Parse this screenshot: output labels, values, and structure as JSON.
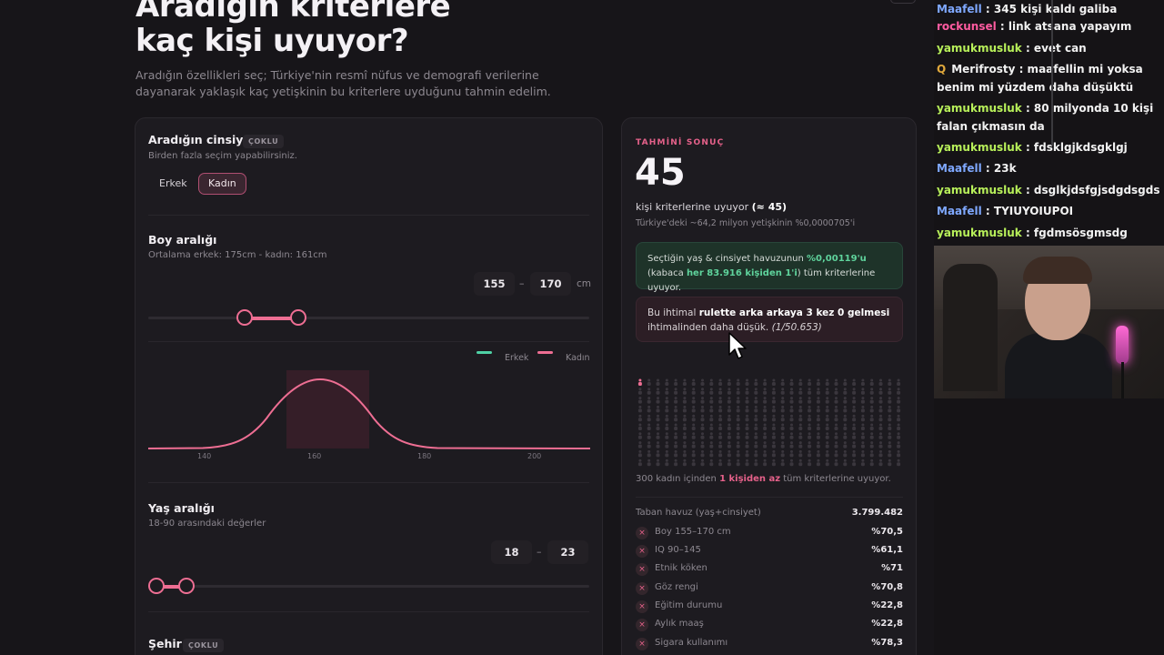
{
  "hero": {
    "title": "Aradığın kriterlere kaç kişi uyuyor?",
    "subtitle": "Aradığın özellikleri seç; Türkiye'nin resmî nüfus ve demografi verilerine dayanarak yaklaşık kaç yetişkinin bu kriterlere uyduğunu tahmin edelim."
  },
  "gender": {
    "title": "Aradığın cinsiyet",
    "tag": "ÇOKLU",
    "desc": "Birden fazla seçim yapabilirsiniz.",
    "options": [
      "Erkek",
      "Kadın"
    ],
    "selected": "Kadın"
  },
  "height": {
    "title": "Boy aralığı",
    "desc": "Ortalama erkek: 175cm - kadın: 161cm",
    "min": "155",
    "max": "170",
    "sep": "–",
    "unit": "cm",
    "legend": [
      "Erkek",
      "Kadın"
    ],
    "axis_ticks": [
      "140",
      "160",
      "180",
      "200"
    ],
    "legend_colors": {
      "erkek": "#4fd1a5",
      "kadin": "#ee6e93"
    }
  },
  "age": {
    "title": "Yaş aralığı",
    "desc": "18-90 arasındaki değerler",
    "min": "18",
    "max": "23",
    "sep": "–"
  },
  "city": {
    "title": "Şehir",
    "tag": "ÇOKLU"
  },
  "result": {
    "kicker": "TAHMİNİ SONUÇ",
    "count": "45",
    "line1_a": "kişi kriterlerine uyuyor ",
    "line1_b": "(≈ 45)",
    "line2": "Türkiye'deki ~64,2 milyon yetişkinin %0,0000705'i",
    "green_a": "Seçtiğin yaş & cinsiyet havuzunun ",
    "green_b": "%0,00119'u",
    "green_c": " (kabaca ",
    "green_d": "her 83.916 kişiden 1'i",
    "green_e": ") tüm kriterlerine uyuyor.",
    "red_a": "Bu ihtimal ",
    "red_b": "rulette arka arkaya 3 kez 0 gelmesi",
    "red_c": " ihtimalinden daha düşük. ",
    "red_d": "(1/50.653)",
    "grid_a": "300 kadın içinden ",
    "grid_b": "1 kişiden az",
    "grid_c": " tüm kriterlerine uyuyor.",
    "base_label": "Taban havuz (yaş+cinsiyet)",
    "base_value": "3.799.482",
    "stats": [
      {
        "label": "Boy 155–170 cm",
        "value": "%70,5"
      },
      {
        "label": "IQ 90–145",
        "value": "%61,1"
      },
      {
        "label": "Etnik köken",
        "value": "%71"
      },
      {
        "label": "Göz rengi",
        "value": "%70,8"
      },
      {
        "label": "Eğitim durumu",
        "value": "%22,8"
      },
      {
        "label": "Aylık maaş",
        "value": "%22,8"
      },
      {
        "label": "Sigara kullanımı",
        "value": "%78,3"
      }
    ],
    "x_glyph": "×"
  },
  "chat": [
    {
      "user": "Maafell",
      "color": "#7fa8ff",
      "text": " : 345 kişi kaldı galiba"
    },
    {
      "user": "rockunsel",
      "color": "#ff5ba0",
      "text": " : link atsana yapayım"
    },
    {
      "user": "yamukmusluk",
      "color": "#b8f05a",
      "text": " : evet can"
    },
    {
      "user": "Merifrosty",
      "color": "#f2f2f2",
      "badge": "Q",
      "text": " : maafellin mi yoksa benim mi yüzdem daha düşüktü"
    },
    {
      "user": "yamukmusluk",
      "color": "#b8f05a",
      "text": " : 80 milyonda 10 kişi falan çıkmasın da"
    },
    {
      "user": "yamukmusluk",
      "color": "#b8f05a",
      "text": " : fdsklgjkdsgklgj"
    },
    {
      "user": "Maafell",
      "color": "#7fa8ff",
      "text": " : 23k"
    },
    {
      "user": "yamukmusluk",
      "color": "#b8f05a",
      "text": " : dsglkjdsfgjsdgdsgds"
    },
    {
      "user": "Maafell",
      "color": "#7fa8ff",
      "text": " : TYIUYOIUPOI"
    },
    {
      "user": "yamukmusluk",
      "color": "#b8f05a",
      "text": " : fgdmsösgmsdg"
    }
  ]
}
